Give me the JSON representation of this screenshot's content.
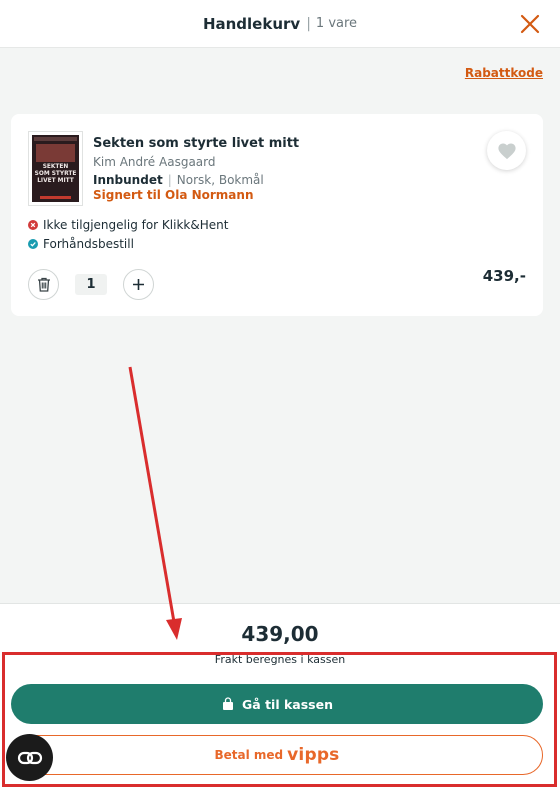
{
  "header": {
    "title": "Handlekurv",
    "separator": "|",
    "count": "1 vare"
  },
  "discount_link": "Rabattkode",
  "item": {
    "cover_text": "SEKTEN\nSOM STYRTE\nLIVET MITT",
    "title": "Sekten som styrte livet mitt",
    "author": "Kim André Aasgaard",
    "format": "Innbundet",
    "format_separator": "|",
    "language": "Norsk, Bokmål",
    "signed": "Signert til Ola Normann",
    "availability": [
      {
        "text": "Ikke tilgjengelig for Klikk&Hent",
        "status": "unavailable"
      },
      {
        "text": "Forhåndsbestill",
        "status": "available"
      }
    ],
    "quantity": "1",
    "price": "439,-"
  },
  "footer": {
    "total": "439,00",
    "shipping_note": "Frakt beregnes i kassen",
    "checkout_label": "Gå til kassen",
    "vipps_label": "Betal med",
    "vipps_logo": "vipps"
  },
  "colors": {
    "accent_orange": "#d35a12",
    "checkout_green": "#1f7d6d",
    "vipps_orange": "#e8682a",
    "annotation_red": "#d92d2d"
  },
  "icons": [
    "close-icon",
    "heart-icon",
    "trash-icon",
    "plus-icon",
    "cart-icon",
    "chat-icon"
  ]
}
